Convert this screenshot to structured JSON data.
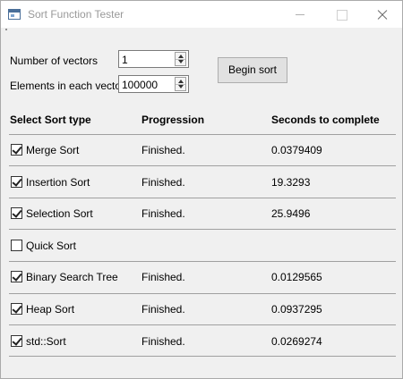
{
  "window": {
    "title": "Sort Function Tester"
  },
  "controls": {
    "vectors_label": "Number of vectors",
    "vectors_value": "1",
    "elements_label": "Elements in each vector",
    "elements_value": "100000",
    "begin_button": "Begin sort"
  },
  "table": {
    "headers": [
      "Select Sort type",
      "Progression",
      "Seconds to complete"
    ],
    "rows": [
      {
        "name": "Merge Sort",
        "checked": true,
        "progress": "Finished.",
        "seconds": "0.0379409"
      },
      {
        "name": "Insertion Sort",
        "checked": true,
        "progress": "Finished.",
        "seconds": "19.3293"
      },
      {
        "name": "Selection Sort",
        "checked": true,
        "progress": "Finished.",
        "seconds": "25.9496"
      },
      {
        "name": "Quick Sort",
        "checked": false,
        "progress": "",
        "seconds": ""
      },
      {
        "name": "Binary Search Tree",
        "checked": true,
        "progress": "Finished.",
        "seconds": "0.0129565"
      },
      {
        "name": "Heap Sort",
        "checked": true,
        "progress": "Finished.",
        "seconds": "0.0937295"
      },
      {
        "name": "std::Sort",
        "checked": true,
        "progress": "Finished.",
        "seconds": "0.0269274"
      }
    ]
  }
}
